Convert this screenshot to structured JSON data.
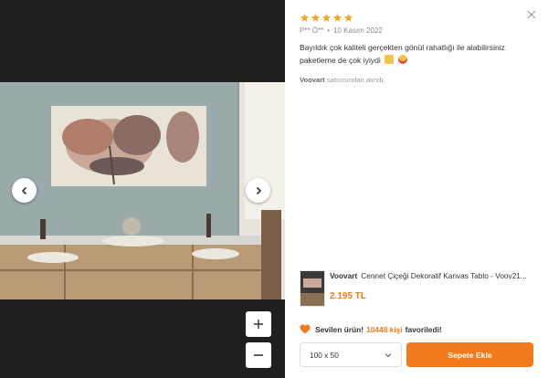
{
  "review": {
    "rating": 5,
    "author": "P** Ö**",
    "date": "10 Kasım 2022",
    "text": "Bayıldık çok kaliteli gerçekten gönül rahatlığı ile alabilirsiniz paketleme de çok iyiydi",
    "seller_name": "Voovart",
    "seller_suffix": "satıcısından alındı."
  },
  "product": {
    "brand": "Voovart",
    "name": "Cennet Çiçeği Dekoratif Kanvas Tablo - Voov21...",
    "price": "2.195 TL"
  },
  "favorites": {
    "prefix": "Sevilen ürün!",
    "count_text": "10448 kişi",
    "suffix": "favoriledi!"
  },
  "size_select": {
    "value": "100 x 50"
  },
  "cart": {
    "label": "Sepete Ekle"
  },
  "colors": {
    "accent": "#f27a1a",
    "star": "#f5a623",
    "viewer_bg": "#1f1f1f"
  },
  "icons": [
    "close-icon",
    "star-icon",
    "chevron-left-icon",
    "chevron-right-icon",
    "plus-icon",
    "minus-icon",
    "heart-icon",
    "chevron-down-icon"
  ]
}
